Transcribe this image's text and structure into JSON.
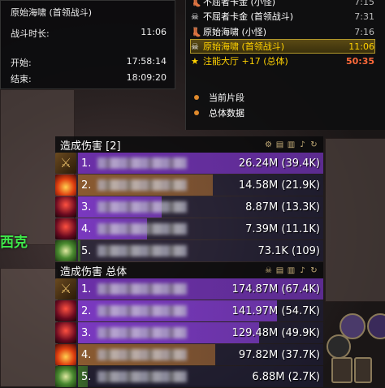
{
  "encounter_info": {
    "title": "原始海啸 (首领战斗)",
    "duration_label": "战斗时长:",
    "duration_value": "11:06",
    "start_label": "开始:",
    "start_value": "17:58:14",
    "end_label": "结束:",
    "end_value": "18:09:20"
  },
  "segments": {
    "items": [
      {
        "name": "不屈者卡金 (小怪)",
        "time": "7:15",
        "icon": "boot-icon"
      },
      {
        "name": "不屈者卡金 (首领战斗)",
        "time": "7:31",
        "icon": "skull-icon"
      },
      {
        "name": "原始海啸 (小怪)",
        "time": "7:16",
        "icon": "boot-icon"
      },
      {
        "name": "原始海啸 (首领战斗)",
        "time": "11:06",
        "icon": "skull-icon"
      },
      {
        "name": "注能大厅 +17 (总体)",
        "time": "50:35",
        "icon": "star-icon"
      }
    ],
    "options": [
      "当前片段",
      "总体数据"
    ]
  },
  "meters": [
    {
      "title": "造成伤害 [2]",
      "rows": [
        {
          "rank": "1.",
          "value": "26.24M (39.4K)",
          "spec": "warrior",
          "bar_color": "#6b2fa8",
          "fill": 1.0
        },
        {
          "rank": "2.",
          "value": "14.58M (21.9K)",
          "spec": "fire",
          "bar_color": "#8a5a30",
          "fill": 0.55
        },
        {
          "rank": "3.",
          "value": "8.87M (13.3K)",
          "spec": "demon",
          "bar_color": "#7a38c0",
          "fill": 0.34
        },
        {
          "rank": "4.",
          "value": "7.39M (11.1K)",
          "spec": "demon",
          "bar_color": "#7a38c0",
          "fill": 0.28
        },
        {
          "rank": "5.",
          "value": "73.1K (109)",
          "spec": "nature",
          "bar_color": "#3a6a28",
          "fill": 0.01
        }
      ]
    },
    {
      "title": "造成伤害 总体",
      "rows": [
        {
          "rank": "1.",
          "value": "174.87M (67.4K)",
          "spec": "warrior",
          "bar_color": "#6b2fa8",
          "fill": 1.0
        },
        {
          "rank": "2.",
          "value": "141.97M (54.7K)",
          "spec": "demon",
          "bar_color": "#7a38c0",
          "fill": 0.81
        },
        {
          "rank": "3.",
          "value": "129.48M (49.9K)",
          "spec": "demon",
          "bar_color": "#7a38c0",
          "fill": 0.74
        },
        {
          "rank": "4.",
          "value": "97.82M (37.7K)",
          "spec": "fire",
          "bar_color": "#8a5a30",
          "fill": 0.56
        },
        {
          "rank": "5.",
          "value": "6.88M (2.7K)",
          "spec": "nature",
          "bar_color": "#3a6a28",
          "fill": 0.04
        }
      ]
    }
  ],
  "zone_text": "西克",
  "colors": {
    "highlight": "#ffd100",
    "total_time": "#ff6a3a",
    "bar_bg": "#2a2a6a"
  }
}
